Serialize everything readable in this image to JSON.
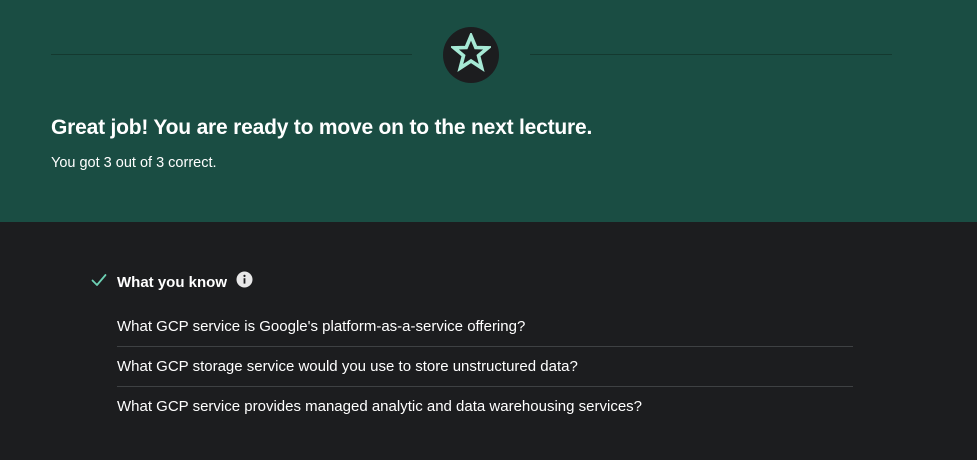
{
  "banner": {
    "title": "Great job! You are ready to move on to the next lecture.",
    "subtitle": "You got 3 out of 3 correct.",
    "badge_icon": "star-icon",
    "colors": {
      "background": "#1a4d43",
      "star": "#a6e9d5",
      "badge": "#1c1d1f"
    }
  },
  "known": {
    "title": "What you know",
    "check_icon": "check-icon",
    "info_icon": "info-icon",
    "questions": [
      "What GCP service is Google's platform-as-a-service offering?",
      "What GCP storage service would you use to store unstructured data?",
      "What GCP service provides managed analytic and data warehousing services?"
    ]
  },
  "colors": {
    "page_background": "#1c1d1f",
    "text": "#ffffff",
    "check": "#6dd1b4",
    "row_divider": "#3e4143"
  }
}
